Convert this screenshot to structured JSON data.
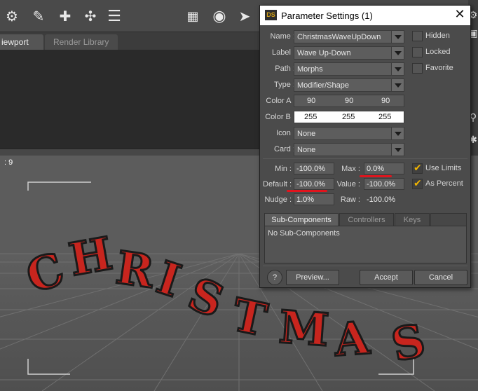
{
  "background": {
    "tabs": [
      "iewport",
      "Render Library"
    ],
    "viewport_label": ": 9",
    "scene_text": "CHRISTMAS"
  },
  "dialog": {
    "logo": "DS",
    "title": "Parameter Settings (1)",
    "close_glyph": "✕",
    "name": {
      "label": "Name :",
      "value": "ChristmasWaveUpDown"
    },
    "display_label": {
      "label": "Label :",
      "value": "Wave Up-Down"
    },
    "path": {
      "label": "Path :",
      "value": "Morphs"
    },
    "type": {
      "label": "Type :",
      "value": "Modifier/Shape"
    },
    "color_a": {
      "label": "Color A :",
      "values": [
        "90",
        "90",
        "90"
      ]
    },
    "color_b": {
      "label": "Color B :",
      "values": [
        "255",
        "255",
        "255"
      ]
    },
    "icon": {
      "label": "Icon :",
      "value": "None"
    },
    "card": {
      "label": "Card :",
      "value": "None"
    },
    "flags": [
      {
        "label": "Hidden",
        "checked": false
      },
      {
        "label": "Locked",
        "checked": false
      },
      {
        "label": "Favorite",
        "checked": false
      }
    ],
    "limits": {
      "min": {
        "label": "Min :",
        "value": "-100.0%"
      },
      "max": {
        "label": "Max :",
        "value": "0.0%"
      },
      "default": {
        "label": "Default :",
        "value": "-100.0%"
      },
      "value": {
        "label": "Value :",
        "value": "-100.0%"
      },
      "nudge": {
        "label": "Nudge :",
        "value": "1.0%"
      },
      "raw": {
        "label": "Raw :",
        "value": "-100.0%"
      }
    },
    "options": [
      {
        "label": "Use Limits",
        "checked": true
      },
      {
        "label": "As Percent",
        "checked": true
      }
    ],
    "subtabs": [
      "Sub-Components",
      "Controllers",
      "Keys"
    ],
    "active_subtab": "Sub-Components",
    "subcomponents_text": "No Sub-Components",
    "buttons": {
      "help": "?",
      "preview": "Preview...",
      "accept": "Accept",
      "cancel": "Cancel"
    },
    "colors": {
      "accent_check": "#f0b400",
      "annotation_red": "#e0141d"
    }
  }
}
